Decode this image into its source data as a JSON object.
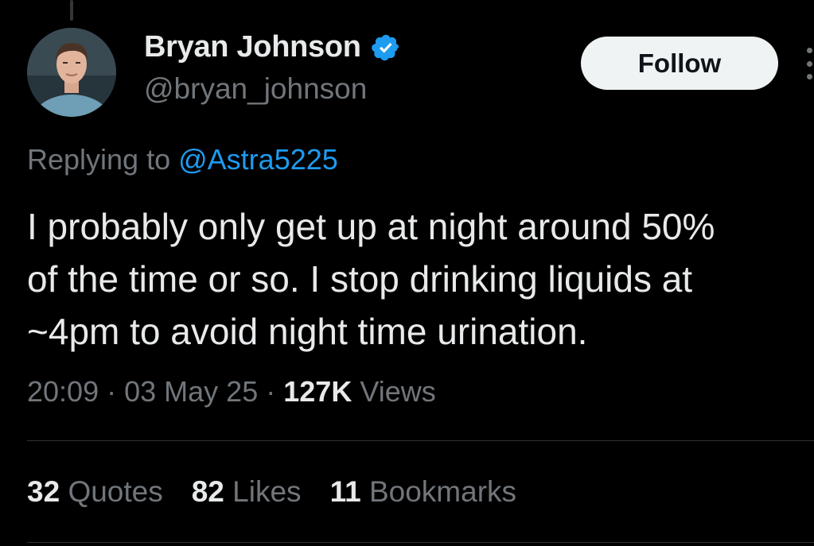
{
  "colors": {
    "background": "#000000",
    "text_primary": "#e7e9ea",
    "text_secondary": "#71767b",
    "accent": "#1d9bf0",
    "button_bg": "#eff3f4",
    "button_text": "#0f1419"
  },
  "author": {
    "name": "Bryan Johnson",
    "handle": "@bryan_johnson",
    "verified_icon": "verified-badge-icon",
    "avatar_icon": "avatar"
  },
  "follow_button": {
    "label": "Follow"
  },
  "more_icon": "more-horizontal-icon",
  "reply": {
    "prefix": "Replying to",
    "mention": "@Astra5225"
  },
  "tweet": {
    "lines": [
      "I probably only get up at night around 50%",
      "of the time or so. I stop drinking liquids at",
      "~4pm to avoid night time urination."
    ]
  },
  "meta": {
    "time": "20:09",
    "separator": "·",
    "date": "03 May 25",
    "views_count": "127K",
    "views_label": "Views"
  },
  "stats": [
    {
      "count": "32",
      "label": "Quotes"
    },
    {
      "count": "82",
      "label": "Likes"
    },
    {
      "count": "11",
      "label": "Bookmarks"
    }
  ]
}
